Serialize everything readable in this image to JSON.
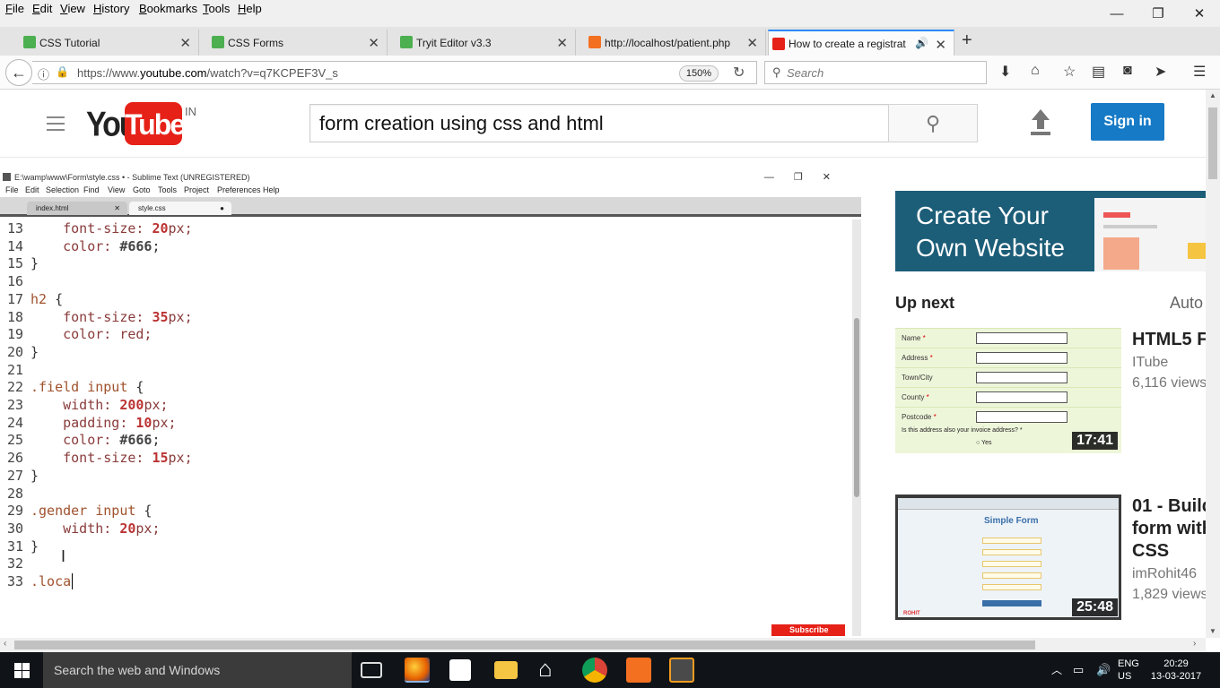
{
  "menubar": {
    "items": [
      "File",
      "Edit",
      "View",
      "History",
      "Bookmarks",
      "Tools",
      "Help"
    ]
  },
  "window_controls": {
    "minimize": "—",
    "maximize": "❐",
    "close": "✕"
  },
  "tabs": [
    {
      "title": "CSS Tutorial",
      "favicon": "w3schools-icon",
      "active": false
    },
    {
      "title": "CSS Forms",
      "favicon": "w3schools-icon",
      "active": false
    },
    {
      "title": "Tryit Editor v3.3",
      "favicon": "w3schools-icon",
      "active": false
    },
    {
      "title": "http://localhost/patient.php",
      "favicon": "xampp-icon",
      "active": false
    },
    {
      "title": "How to create a registrat",
      "favicon": "youtube-icon",
      "active": true
    }
  ],
  "new_tab_label": "+",
  "navbar": {
    "url_prefix": "https://www.",
    "url_domain": "youtube.com",
    "url_path": "/watch?v=q7KCPEF3V_s",
    "zoom": "150%",
    "search_placeholder": "Search"
  },
  "youtube": {
    "logo_you": "You",
    "logo_tube": "Tube",
    "country": "IN",
    "search_query": "form creation using css and html",
    "signin_label": "Sign in",
    "brand_red": "#e62117",
    "signin_blue": "#167ac6"
  },
  "sublime": {
    "window_title": "E:\\wamp\\www\\Form\\style.css • - Sublime Text (UNREGISTERED)",
    "menus": [
      "File",
      "Edit",
      "Selection",
      "Find",
      "View",
      "Goto",
      "Tools",
      "Project",
      "Preferences",
      "Help"
    ],
    "tabs": [
      {
        "name": "index.html",
        "active": false
      },
      {
        "name": "style.css",
        "active": true
      }
    ],
    "lines": [
      {
        "n": "13",
        "tokens": [
          [
            "prop",
            "    font-size: "
          ],
          [
            "num",
            "20"
          ],
          [
            "prop",
            "px;"
          ]
        ]
      },
      {
        "n": "14",
        "tokens": [
          [
            "prop",
            "    color: "
          ],
          [
            "hex",
            "#666"
          ],
          [
            "code",
            ";"
          ]
        ]
      },
      {
        "n": "15",
        "tokens": [
          [
            "code",
            "}"
          ]
        ]
      },
      {
        "n": "16",
        "tokens": []
      },
      {
        "n": "17",
        "tokens": [
          [
            "sel",
            "h2"
          ],
          [
            "code",
            " {"
          ]
        ]
      },
      {
        "n": "18",
        "tokens": [
          [
            "prop",
            "    font-size: "
          ],
          [
            "num",
            "35"
          ],
          [
            "prop",
            "px;"
          ]
        ]
      },
      {
        "n": "19",
        "tokens": [
          [
            "prop",
            "    color: red;"
          ]
        ]
      },
      {
        "n": "20",
        "tokens": [
          [
            "code",
            "}"
          ]
        ]
      },
      {
        "n": "21",
        "tokens": []
      },
      {
        "n": "22",
        "tokens": [
          [
            "sel",
            ".field input"
          ],
          [
            "code",
            " {"
          ]
        ]
      },
      {
        "n": "23",
        "tokens": [
          [
            "prop",
            "    width: "
          ],
          [
            "num",
            "200"
          ],
          [
            "prop",
            "px;"
          ]
        ]
      },
      {
        "n": "24",
        "tokens": [
          [
            "prop",
            "    padding: "
          ],
          [
            "num",
            "10"
          ],
          [
            "prop",
            "px;"
          ]
        ]
      },
      {
        "n": "25",
        "tokens": [
          [
            "prop",
            "    color: "
          ],
          [
            "hex",
            "#666"
          ],
          [
            "code",
            ";"
          ]
        ]
      },
      {
        "n": "26",
        "tokens": [
          [
            "prop",
            "    font-size: "
          ],
          [
            "num",
            "15"
          ],
          [
            "prop",
            "px;"
          ]
        ]
      },
      {
        "n": "27",
        "tokens": [
          [
            "code",
            "}"
          ]
        ]
      },
      {
        "n": "28",
        "tokens": []
      },
      {
        "n": "29",
        "tokens": [
          [
            "sel",
            ".gender input"
          ],
          [
            "code",
            " {"
          ]
        ]
      },
      {
        "n": "30",
        "tokens": [
          [
            "prop",
            "    width: "
          ],
          [
            "num",
            "20"
          ],
          [
            "prop",
            "px;"
          ]
        ]
      },
      {
        "n": "31",
        "tokens": [
          [
            "code",
            "}"
          ]
        ]
      },
      {
        "n": "32",
        "tokens": []
      },
      {
        "n": "33",
        "tokens": [
          [
            "sel",
            ".loca"
          ]
        ]
      }
    ],
    "subscribe_watermark": "Subscribe"
  },
  "sidebar": {
    "ad_title": "Create Your Own Website",
    "up_next": "Up next",
    "autoplay": "Auto",
    "videos": [
      {
        "title": "HTML5 F",
        "channel": "ITube",
        "views": "6,116 views",
        "duration": "17:41",
        "thumb_form": {
          "rows": [
            {
              "label": "Name",
              "required": true
            },
            {
              "label": "Address",
              "required": true
            },
            {
              "label": "Town/City",
              "required": false
            },
            {
              "label": "County",
              "required": true
            },
            {
              "label": "Postcode",
              "required": true
            }
          ],
          "required_mark": "*",
          "question": "Is this address also your invoice address? *",
          "option": "Yes"
        }
      },
      {
        "title": "01 - Build form with CSS",
        "title_lines": [
          "01 - Build",
          "form with",
          "CSS"
        ],
        "channel": "imRohit46",
        "views": "1,829 views",
        "duration": "25:48",
        "thumb_heading": "Simple Form",
        "thumb_logo": "ROHIT"
      }
    ]
  },
  "taskbar": {
    "search_placeholder": "Search the web and Windows",
    "apps": [
      "task-view-icon",
      "firefox-icon",
      "store-icon",
      "file-explorer-icon",
      "home-icon",
      "chrome-icon",
      "xampp-icon",
      "sublime-text-icon"
    ],
    "lang_line1": "ENG",
    "lang_line2": "US",
    "time": "20:29",
    "date": "13-03-2017"
  }
}
